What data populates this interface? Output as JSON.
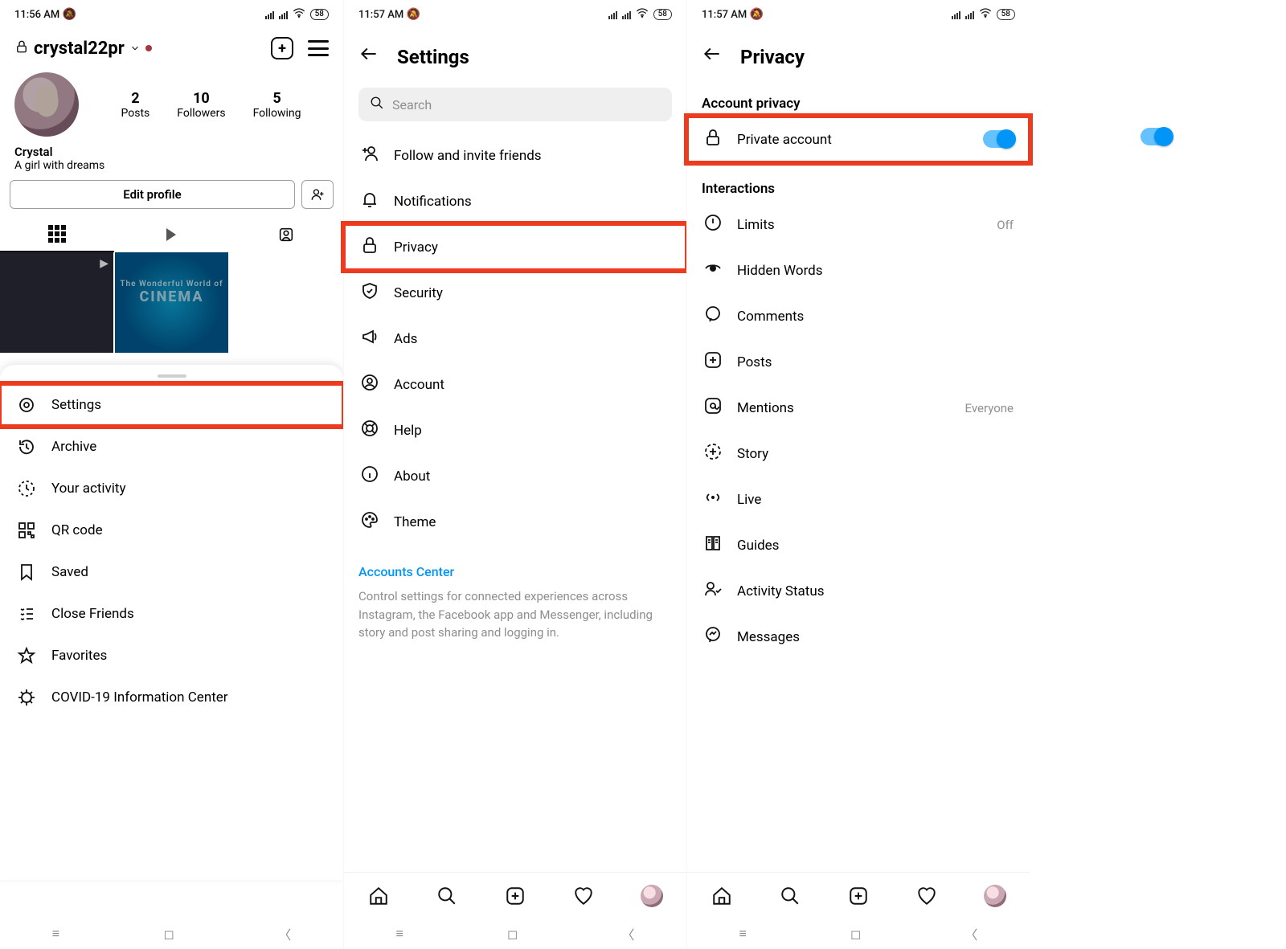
{
  "screen1": {
    "status": {
      "time": "11:56 AM",
      "battery": "58"
    },
    "username": "crystal22pr",
    "stats": {
      "posts": {
        "n": "2",
        "l": "Posts"
      },
      "followers": {
        "n": "10",
        "l": "Followers"
      },
      "following": {
        "n": "5",
        "l": "Following"
      }
    },
    "display_name": "Crystal",
    "bio": "A girl with dreams",
    "edit": "Edit profile",
    "cinema_top": "The Wonderful World of",
    "cinema_big": "CINEMA",
    "menu": {
      "settings": "Settings",
      "archive": "Archive",
      "activity": "Your activity",
      "qr": "QR code",
      "saved": "Saved",
      "close_friends": "Close Friends",
      "favorites": "Favorites",
      "covid": "COVID-19 Information Center"
    }
  },
  "screen2": {
    "status": {
      "time": "11:57 AM",
      "battery": "58"
    },
    "title": "Settings",
    "search_placeholder": "Search",
    "items": {
      "follow": "Follow and invite friends",
      "notifications": "Notifications",
      "privacy": "Privacy",
      "security": "Security",
      "ads": "Ads",
      "account": "Account",
      "help": "Help",
      "about": "About",
      "theme": "Theme"
    },
    "accounts_center": {
      "title": "Accounts Center",
      "desc": "Control settings for connected experiences across Instagram, the Facebook app and Messenger, including story and post sharing and logging in."
    }
  },
  "screen3": {
    "status": {
      "time": "11:57 AM",
      "battery": "58"
    },
    "title": "Privacy",
    "section_account": "Account privacy",
    "private_account": "Private account",
    "section_interactions": "Interactions",
    "items": {
      "limits": {
        "label": "Limits",
        "value": "Off"
      },
      "hidden_words": {
        "label": "Hidden Words"
      },
      "comments": {
        "label": "Comments"
      },
      "posts": {
        "label": "Posts"
      },
      "mentions": {
        "label": "Mentions",
        "value": "Everyone"
      },
      "story": {
        "label": "Story"
      },
      "live": {
        "label": "Live"
      },
      "guides": {
        "label": "Guides"
      },
      "activity": {
        "label": "Activity Status"
      },
      "messages": {
        "label": "Messages"
      }
    }
  }
}
